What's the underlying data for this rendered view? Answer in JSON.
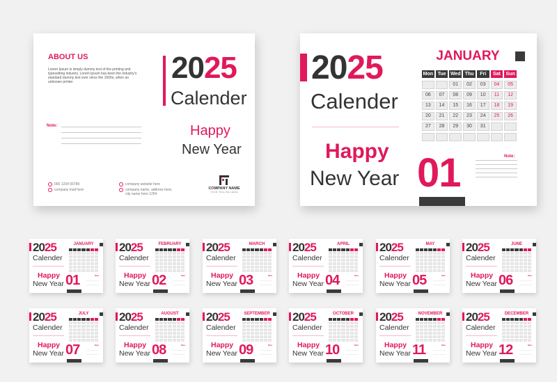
{
  "colors": {
    "accent": "#e0195a",
    "dark": "#333333",
    "background": "#f1f1f1"
  },
  "back_card": {
    "about_title": "ABOUT US",
    "about_text": "Lorem Ipsum is simply dummy text of the printing and typesetting industry. Lorem Ipsum has been the industry's standard dummy text ever since the 1500s, when an unknown printer",
    "year_prefix": "20",
    "year_suffix": "25",
    "calendar_word": "Calender",
    "note_label": "Note:",
    "happy": "Happy",
    "new_year": "New Year",
    "contacts": [
      {
        "icon": "phone-icon",
        "text": "000 1234 56789"
      },
      {
        "icon": "mail-icon",
        "text": "company mail here"
      },
      {
        "icon": "web-icon",
        "text": "company website here"
      },
      {
        "icon": "location-icon",
        "text": "company name, address here, city name here 1254"
      }
    ],
    "company_name": "COMPANY NAME",
    "company_tagline": "YOUR TAGLINE HERE"
  },
  "front_card": {
    "year_prefix": "20",
    "year_suffix": "25",
    "calendar_word": "Calender",
    "happy": "Happy",
    "new_year": "New Year",
    "month_name": "JANUARY",
    "month_number": "01",
    "note_label": "Note:",
    "weekdays": [
      "Mon",
      "Tue",
      "Wed",
      "Thu",
      "Fri",
      "Sat",
      "Sun"
    ],
    "days": [
      "",
      "",
      "01",
      "02",
      "03",
      "04",
      "05",
      "06",
      "07",
      "08",
      "09",
      "10",
      "11",
      "12",
      "13",
      "14",
      "15",
      "16",
      "17",
      "18",
      "19",
      "20",
      "21",
      "22",
      "23",
      "24",
      "25",
      "26",
      "27",
      "28",
      "29",
      "30",
      "31",
      "",
      "",
      "",
      "",
      "",
      "",
      "",
      "",
      ""
    ]
  },
  "months": [
    {
      "name": "JANUARY",
      "number": "01"
    },
    {
      "name": "FEBRUARY",
      "number": "02"
    },
    {
      "name": "MARCH",
      "number": "03"
    },
    {
      "name": "APRIL",
      "number": "04"
    },
    {
      "name": "MAY",
      "number": "05"
    },
    {
      "name": "JUNE",
      "number": "06"
    },
    {
      "name": "JULY",
      "number": "07"
    },
    {
      "name": "AUGUST",
      "number": "08"
    },
    {
      "name": "SEPTEMBER",
      "number": "09"
    },
    {
      "name": "OCTOBER",
      "number": "10"
    },
    {
      "name": "NOVEMBER",
      "number": "11"
    },
    {
      "name": "DECEMBER",
      "number": "12"
    }
  ]
}
